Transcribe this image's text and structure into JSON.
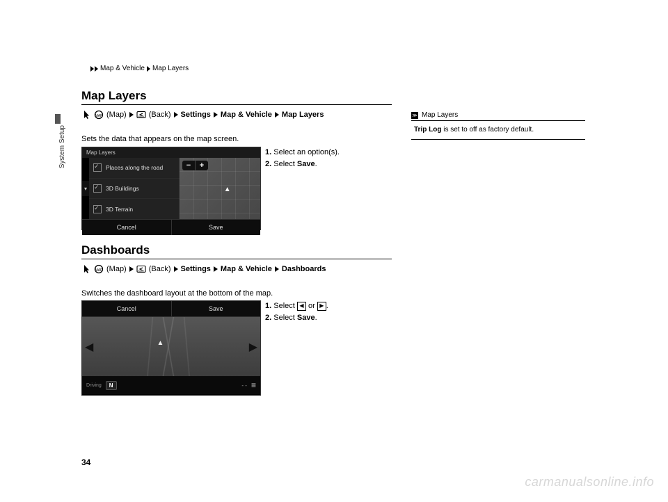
{
  "breadcrumb": {
    "seg1": "Map & Vehicle",
    "seg2": "Map Layers"
  },
  "side_tab_label": "System Setup",
  "section1": {
    "title": "Map Layers",
    "nav": {
      "map": "(Map)",
      "back": "(Back)",
      "settings": "Settings",
      "mapvehicle": "Map & Vehicle",
      "maplayers": "Map Layers"
    },
    "desc": "Sets the data that appears on the map screen.",
    "steps": {
      "s1_num": "1.",
      "s1_txt": "Select an option(s).",
      "s2_num": "2.",
      "s2_pre": "Select ",
      "s2_sel": "Save",
      "s2_post": "."
    },
    "ui": {
      "header": "Map Layers",
      "row1": "Places along the road",
      "row2": "3D Buildings",
      "row3": "3D Terrain",
      "zoom_minus": "−",
      "zoom_plus": "+",
      "cancel": "Cancel",
      "save": "Save"
    }
  },
  "section2": {
    "title": "Dashboards",
    "nav": {
      "map": "(Map)",
      "back": "(Back)",
      "settings": "Settings",
      "mapvehicle": "Map & Vehicle",
      "dashboards": "Dashboards"
    },
    "desc": "Switches the dashboard layout at the bottom of the map.",
    "steps": {
      "s1_num": "1.",
      "s1_pre": "Select ",
      "s1_or": " or ",
      "s1_post": ".",
      "s2_num": "2.",
      "s2_pre": "Select ",
      "s2_sel": "Save",
      "s2_post": "."
    },
    "ui": {
      "cancel": "Cancel",
      "save": "Save",
      "driving": "Driving",
      "dir": "N",
      "dashes": "- -",
      "menu": "≡"
    }
  },
  "sidebox": {
    "icon": "≫",
    "title": "Map Layers",
    "note_bold": "Trip Log",
    "note_rest": " is set to off as factory default."
  },
  "page_number": "34",
  "watermark": "carmanualsonline.info"
}
